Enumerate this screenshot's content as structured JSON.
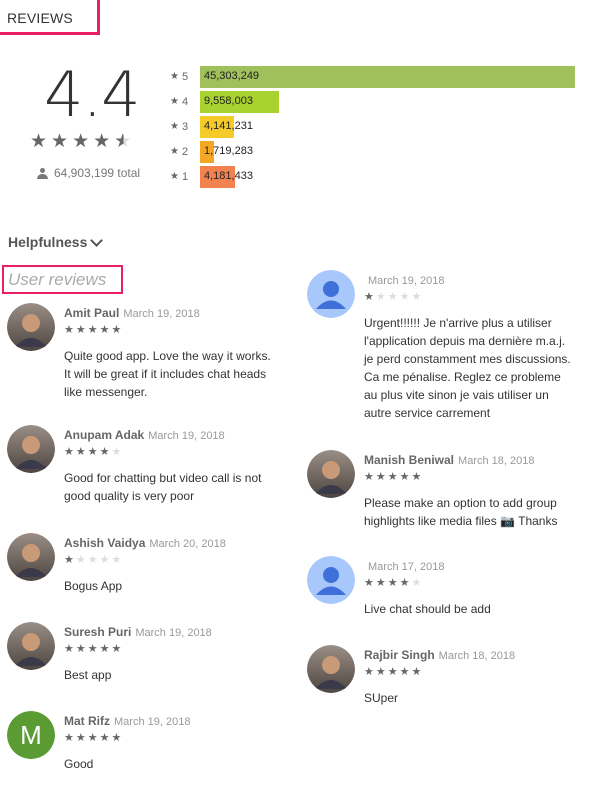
{
  "header": {
    "reviews_label": "REVIEWS"
  },
  "summary": {
    "score": "4.4",
    "star_value": 4.4,
    "total": "64,903,199 total"
  },
  "histogram": [
    {
      "stars": "5",
      "value": "45,303,249",
      "fraction": 1.0,
      "color": "#9fc05a"
    },
    {
      "stars": "4",
      "value": "9,558,003",
      "fraction": 0.211,
      "color": "#a8d22f"
    },
    {
      "stars": "3",
      "value": "4,141,231",
      "fraction": 0.091,
      "color": "#f5cb2a"
    },
    {
      "stars": "2",
      "value": "1,719,283",
      "fraction": 0.038,
      "color": "#f5a623"
    },
    {
      "stars": "1",
      "value": "4,181,433",
      "fraction": 0.092,
      "color": "#f28351"
    }
  ],
  "controls": {
    "helpfulness_label": "Helpfulness"
  },
  "user_reviews": {
    "title": "User reviews",
    "left": [
      {
        "name": "Amit Paul",
        "date": "March 19, 2018",
        "rating": 5,
        "text": "Quite good app. Love the way it works. It will be great if it includes chat heads like messenger.",
        "avatar": "photo"
      },
      {
        "name": "Anupam Adak",
        "date": "March 19, 2018",
        "rating": 4,
        "text": "Good for chatting but video call is not good quality is very poor",
        "avatar": "photo"
      },
      {
        "name": "Ashish Vaidya",
        "date": "March 20, 2018",
        "rating": 1,
        "text": "Bogus App",
        "avatar": "photo"
      },
      {
        "name": "Suresh Puri",
        "date": "March 19, 2018",
        "rating": 5,
        "text": "Best app",
        "avatar": "photo"
      },
      {
        "name": "Mat Rifz",
        "date": "March 19, 2018",
        "rating": 5,
        "text": "Good",
        "avatar": "letter",
        "letter": "M"
      }
    ],
    "right": [
      {
        "name": "",
        "date": "March 19, 2018",
        "rating": 1,
        "text": "Urgent!!!!!! Je n'arrive plus a utiliser l'application depuis ma dernière m.a.j. je perd constamment mes discussions. Ca me pénalise. Reglez ce probleme au plus vite sinon je vais utiliser un autre service carrement",
        "avatar": "default"
      },
      {
        "name": "Manish Beniwal",
        "date": "March 18, 2018",
        "rating": 5,
        "text": "Please make an option to add group highlights like media files 📷 Thanks",
        "avatar": "photo"
      },
      {
        "name": "",
        "date": "March 17, 2018",
        "rating": 4,
        "text": "Live chat should be add",
        "avatar": "default"
      },
      {
        "name": "Rajbir Singh",
        "date": "March 18, 2018",
        "rating": 5,
        "text": "SUper",
        "avatar": "photo"
      }
    ]
  },
  "colors": {
    "accent": "#e91e63",
    "default_avatar": "#a8c7fa",
    "letter_avatar": "#5a9b33"
  }
}
